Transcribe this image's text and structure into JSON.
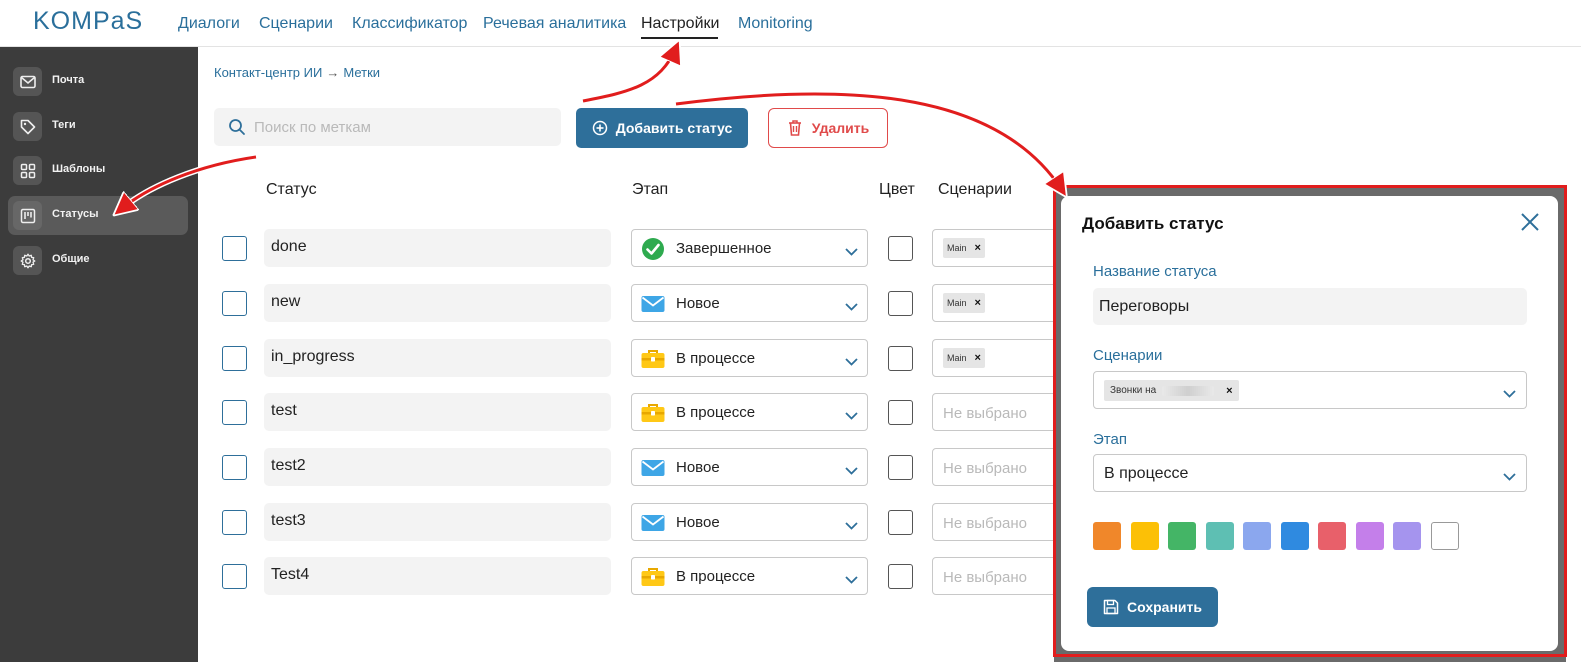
{
  "app": {
    "logo": "KOMPaS"
  },
  "nav": {
    "items": [
      {
        "label": "Диалоги"
      },
      {
        "label": "Сценарии"
      },
      {
        "label": "Классификатор"
      },
      {
        "label": "Речевая аналитика"
      },
      {
        "label": "Настройки",
        "active": true
      },
      {
        "label": "Monitoring"
      }
    ]
  },
  "sidebar": {
    "items": [
      {
        "label": "Почта",
        "icon": "mail-icon"
      },
      {
        "label": "Теги",
        "icon": "tag-icon"
      },
      {
        "label": "Шаблоны",
        "icon": "grid-icon"
      },
      {
        "label": "Статусы",
        "icon": "kanban-icon",
        "active": true
      },
      {
        "label": "Общие",
        "icon": "gear-icon"
      }
    ]
  },
  "breadcrumb": {
    "parent": "Контакт-центр ИИ",
    "current": "Метки"
  },
  "search": {
    "placeholder": "Поиск по меткам",
    "value": ""
  },
  "toolbar": {
    "add_label": "Добавить статус",
    "delete_label": "Удалить"
  },
  "table": {
    "columns": [
      "Статус",
      "Этап",
      "Цвет",
      "Сценарии"
    ],
    "placeholder_scenario": "Не выбрано",
    "rows": [
      {
        "name": "done",
        "stage": "Завершенное",
        "stage_icon": "check-circle-icon",
        "scenario": "Main"
      },
      {
        "name": "new",
        "stage": "Новое",
        "stage_icon": "envelope-icon",
        "scenario": "Main"
      },
      {
        "name": "in_progress",
        "stage": "В процессе",
        "stage_icon": "briefcase-icon",
        "scenario": "Main"
      },
      {
        "name": "test",
        "stage": "В процессе",
        "stage_icon": "briefcase-icon",
        "scenario": ""
      },
      {
        "name": "test2",
        "stage": "Новое",
        "stage_icon": "envelope-icon",
        "scenario": ""
      },
      {
        "name": "test3",
        "stage": "Новое",
        "stage_icon": "envelope-icon",
        "scenario": ""
      },
      {
        "name": "Test4",
        "stage": "В процессе",
        "stage_icon": "briefcase-icon",
        "scenario": ""
      }
    ]
  },
  "modal": {
    "title": "Добавить статус",
    "name_label": "Название статуса",
    "name_value": "Переговоры",
    "scenarios_label": "Сценарии",
    "scenario_tag": "Звонки на",
    "stage_label": "Этап",
    "stage_value": "В процессе",
    "save_label": "Сохранить",
    "colors": [
      "#f0872a",
      "#fcc006",
      "#44b566",
      "#5ebfb3",
      "#8ba7ee",
      "#2f8ae0",
      "#e8606a",
      "#c47fea",
      "#a594ee",
      "#ffffff"
    ]
  },
  "colors": {
    "accent": "#2e6f9a",
    "danger": "#e04a4a",
    "sidebar_bg": "#3c3c3c"
  }
}
